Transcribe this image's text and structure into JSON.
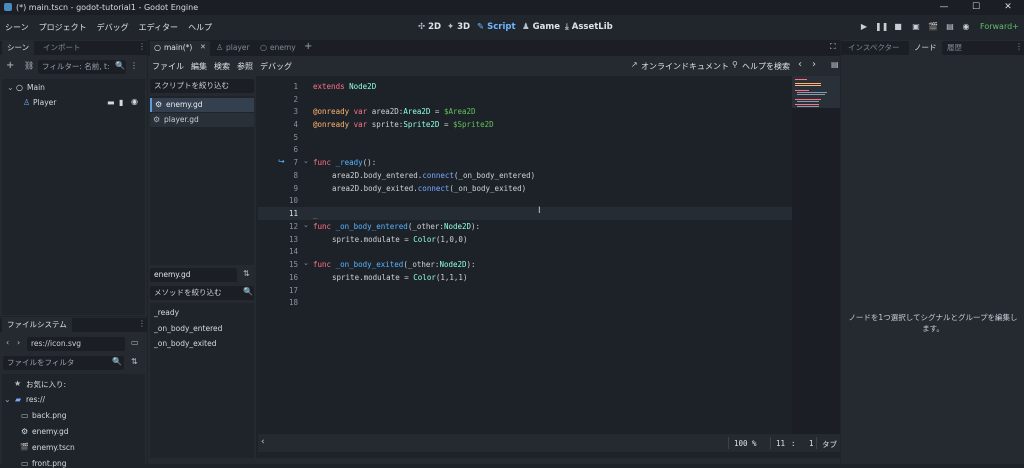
{
  "window": {
    "title": "(*) main.tscn - godot-tutorial1 - Godot Engine",
    "minimize": "—",
    "maximize": "☐",
    "close": "✕"
  },
  "menu": [
    "シーン",
    "プロジェクト",
    "デバッグ",
    "エディター",
    "ヘルプ"
  ],
  "workspaces": [
    {
      "icon": "✣",
      "label": "2D"
    },
    {
      "icon": "✦",
      "label": "3D"
    },
    {
      "icon": "✎",
      "label": "Script"
    },
    {
      "icon": "♟",
      "label": "Game"
    },
    {
      "icon": "⤓",
      "label": "AssetLib"
    }
  ],
  "renderer": "Forward+",
  "scene_dock": {
    "tabs": [
      "シーン",
      "インポート"
    ],
    "filter_placeholder": "フィルター: 名前, t:",
    "nodes": [
      {
        "name": "Main",
        "icon": "○"
      },
      {
        "name": "Player",
        "icon": "♙"
      }
    ]
  },
  "filesystem": {
    "title": "ファイルシステム",
    "path": "res://icon.svg",
    "filter_placeholder": "ファイルをフィルタ",
    "items": [
      {
        "label": "お気に入り:",
        "icon": "★"
      },
      {
        "label": "res://",
        "icon": "▰"
      },
      {
        "label": "back.png",
        "icon": "▭"
      },
      {
        "label": "enemy.gd",
        "icon": "⚙"
      },
      {
        "label": "enemy.tscn",
        "icon": "🎬"
      },
      {
        "label": "front.png",
        "icon": "▭"
      }
    ]
  },
  "editor_tabs": [
    {
      "label": "main(*)",
      "close": "✕"
    },
    {
      "label": "player"
    },
    {
      "label": "enemy"
    }
  ],
  "add_tab": "+",
  "script_menu": [
    "ファイル",
    "編集",
    "検索",
    "参照",
    "デバッグ"
  ],
  "online_docs": "オンラインドキュメント",
  "help_search": "ヘルプを検索",
  "script_filter_placeholder": "スクリプトを絞り込む",
  "scripts": [
    "enemy.gd",
    "player.gd"
  ],
  "current_script": "enemy.gd",
  "method_filter_placeholder": "メソッドを絞り込む",
  "methods": [
    "_ready",
    "_on_body_entered",
    "_on_body_exited"
  ],
  "code": {
    "line_numbers": [
      "1",
      "2",
      "3",
      "4",
      "5",
      "6",
      "7",
      "8",
      "9",
      "10",
      "11",
      "12",
      "13",
      "14",
      "15",
      "16",
      "17",
      "18"
    ],
    "l1": {
      "kw": "extends",
      "rest": " Node2D"
    },
    "l3": {
      "ann": "@onready",
      "var": " var ",
      "name": "area2D:",
      "type": "Area2D",
      "eq": " = ",
      "path": "$Area2D"
    },
    "l4": {
      "ann": "@onready",
      "var": " var ",
      "name": "sprite:",
      "type": "Sprite2D",
      "eq": " = ",
      "path": "$Sprite2D"
    },
    "l7": {
      "kw": "func",
      "name": " _ready",
      "rest": "():"
    },
    "l8": {
      "pre": "area2D.body_entered.",
      "fn": "connect",
      "rest": "(_on_body_entered)"
    },
    "l9": {
      "pre": "area2D.body_exited.",
      "fn": "connect",
      "rest": "(_on_body_exited)"
    },
    "l12": {
      "kw": "func",
      "name": " _on_body_entered",
      "pre": "(_other:",
      "type": "Node2D",
      "post": "):"
    },
    "l13": {
      "pre": "sprite.modulate = ",
      "type": "Color",
      "rest": "(1,0,0)"
    },
    "l15": {
      "kw": "func",
      "name": " _on_body_exited",
      "pre": "(_other:",
      "type": "Node2D",
      "post": "):"
    },
    "l16": {
      "pre": "sprite.modulate = ",
      "type": "Color",
      "rest": "(1,1,1)"
    },
    "caret": "_"
  },
  "status": {
    "zoom": "100 %",
    "line": "11",
    "sep": ":",
    "col": "1",
    "indent": "タブ"
  },
  "inspector": {
    "tabs": [
      "インスペクター",
      "ノード",
      "履歴"
    ],
    "message": "ノードを1つ選択してシグナルとグループを編集します。"
  }
}
